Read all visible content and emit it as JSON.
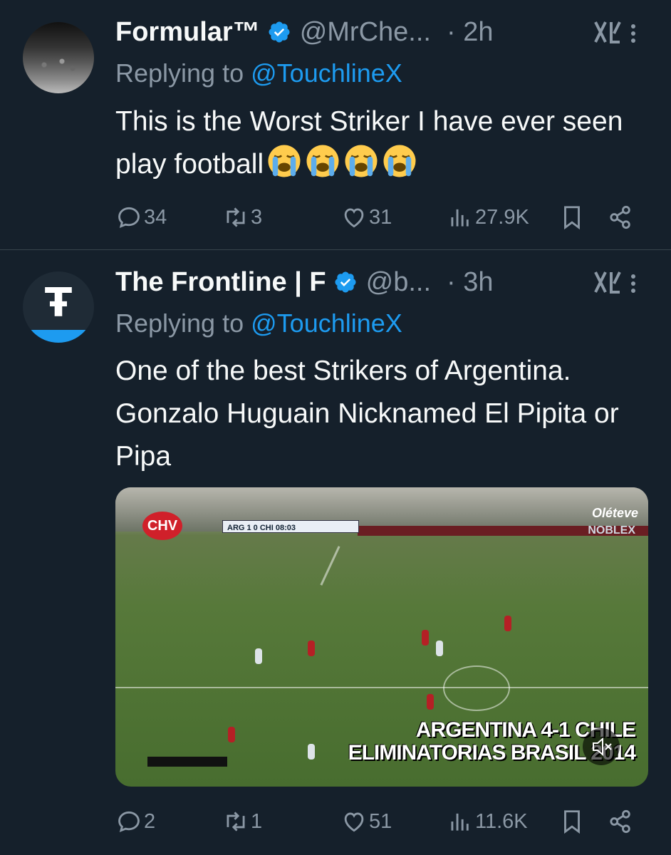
{
  "tweets": [
    {
      "display_name": "Formular™",
      "handle": "@MrChe...",
      "time": "· 2h",
      "replying_label": "Replying to",
      "replying_to": "@TouchlineX",
      "text": "This is the Worst Striker I have ever seen play football",
      "emoji": [
        "loudly-crying-face",
        "loudly-crying-face",
        "loudly-crying-face",
        "loudly-crying-face"
      ],
      "stats": {
        "replies": "34",
        "retweets": "3",
        "likes": "31",
        "views": "27.9K"
      }
    },
    {
      "display_name": "The Frontline | F",
      "handle": "@b...",
      "time": "· 3h",
      "replying_label": "Replying to",
      "replying_to": "@TouchlineX",
      "text": "One of the best Strikers of Argentina. Gonzalo Huguain Nicknamed El Pipita or Pipa",
      "avatar_glyph": "Ŧ",
      "media": {
        "overlay_line1": "ARGENTINA 4-1 CHILE",
        "overlay_line2": "ELIMINATORIAS BRASIL 2014",
        "broadcaster": "CHV",
        "sponsor_top": "Oléteve",
        "sponsor_bottom": "NOBLEX",
        "score": "ARG 1 0 CHI 08:03"
      },
      "stats": {
        "replies": "2",
        "retweets": "1",
        "likes": "51",
        "views": "11.6K"
      }
    }
  ],
  "colors": {
    "background": "#15202b",
    "text": "#f7f9f9",
    "muted": "#8b98a5",
    "accent": "#1d9bf0",
    "divider": "#38444d"
  },
  "icons": [
    "verified-badge-icon",
    "grok-icon",
    "more-icon",
    "reply-icon",
    "retweet-icon",
    "like-icon",
    "views-icon",
    "bookmark-icon",
    "share-icon",
    "mute-icon"
  ]
}
